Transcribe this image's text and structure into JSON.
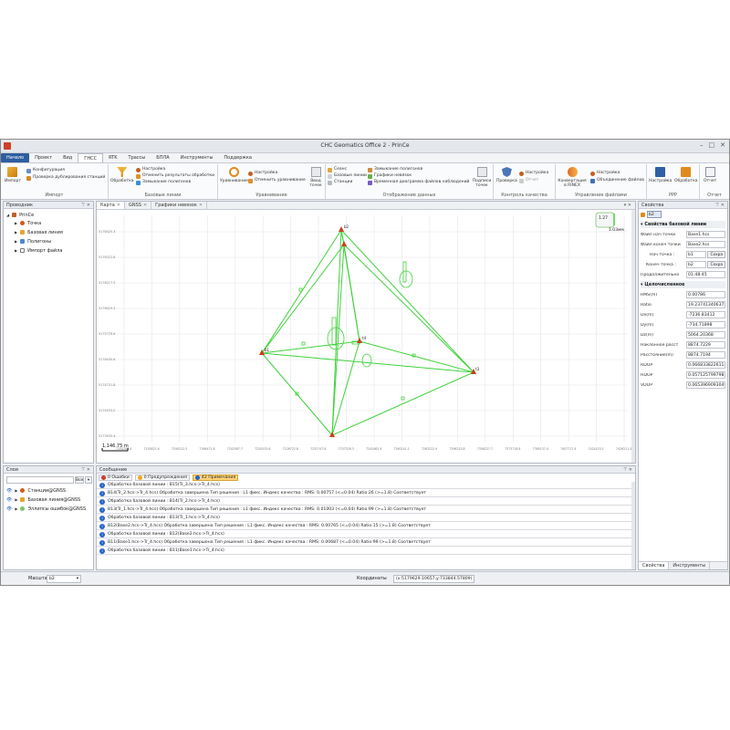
{
  "app": {
    "title": "CHC Geomatics Office 2 - PrinCe"
  },
  "menu": {
    "items": [
      "Начало",
      "Проект",
      "Вид",
      "ГНСС",
      "RTK",
      "Трассы",
      "БПЛА",
      "Инструменты",
      "Поддержка"
    ],
    "active": "ГНСС"
  },
  "ribbon": {
    "import": {
      "title": "Импорт",
      "big": "Импорт",
      "b1": "Конфигурация",
      "b2": "Проверка дублирования станций"
    },
    "baselines": {
      "title": "Базовые линии",
      "big": "Обработка",
      "b1": "Настройка",
      "b2": "Отменить результаты обработки",
      "b3": "Замыкание полигонов"
    },
    "adjust": {
      "title": "Уравнивание",
      "big": "Уравнивание",
      "b1": "Настройка",
      "b2": "Отменить уравнивание",
      "big2": "Ввод точек"
    },
    "display": {
      "title": "Отображение данных",
      "b1": "Сеанс",
      "b2": "Базовые линии",
      "b3": "Станции",
      "b4": "Замыкание полигонов",
      "b5": "Графики невязок",
      "b6": "Временная диаграмма файлов наблюдений",
      "big": "Подписи точек"
    },
    "quality": {
      "title": "Контроль качества",
      "big": "Проверка",
      "b1": "Настройка",
      "b2": "Отчет"
    },
    "files": {
      "title": "Управление файлами",
      "big": "Конвертация в RINEX",
      "b1": "Настройка",
      "b2": "Объединение файлов"
    },
    "ppp": {
      "title": "PPP",
      "big1": "Настройка",
      "big2": "Обработка"
    },
    "report": {
      "title": "Отчет",
      "big": "Отчет"
    }
  },
  "explorer": {
    "title": "Проводник",
    "root": "PrinCe",
    "items": [
      "Точка",
      "Базовая линия",
      "Полигоны",
      "Импорт файла"
    ]
  },
  "layers": {
    "title": "Слои",
    "placeholder": "",
    "all_label": "Все",
    "items": [
      "Станции@GNSS",
      "Базовая линия@GNSS",
      "Эллипсы ошибок@GNSS"
    ]
  },
  "map_tabs": [
    "Карта",
    "GNSS",
    "Графики невязок"
  ],
  "map": {
    "y_ticks": [
      "5176425.3",
      "5176322.8",
      "5176217.5",
      "5176029.3",
      "5175729.6",
      "5176430.6",
      "5174731.8",
      "5174033.0",
      "5173935.4"
    ],
    "x_ticks": [
      "7150203.4",
      "7155821.6",
      "7190212.5",
      "7198471.8",
      "7202587.7",
      "7220533.8",
      "7226722.8",
      "7232747.8",
      "7237328.3",
      "7242463.9",
      "7260241.1",
      "7263222.9",
      "7296215.8",
      "7356227.7",
      "7373718.8",
      "7385137.4",
      "7407717.4",
      "7424153.1",
      "7426211.4"
    ],
    "scale_label": "1,146.75 m",
    "compass_value": "1.27",
    "compass_unit": "1.03мм"
  },
  "messages": {
    "title": "Сообщение",
    "filters": {
      "errors": "0 Ошибки",
      "warnings": "0 Предупреждения",
      "info": "42 Примечания"
    },
    "rows": [
      "Обработка базовой линии :  B15(Tr_3.hcs->Tr_4.hcs)",
      "B14(Tr_2.hcs->Tr_4.hcs)  Обработка завершена   Тип решения :   L1 фикс.   Индекс качества : RMS: 0.00757  (<=0.04) Ratio:26  (>=1.8)  Соответствует",
      "Обработка базовой линии :  B14(Tr_2.hcs->Tr_4.hcs)",
      "B13(Tr_1.hcs->Tr_4.hcs)  Обработка завершена   Тип решения :   L1 фикс.   Индекс качества : RMS: 0.01003  (<=0.04) Ratio:99  (>=1.8)  Соответствует",
      "Обработка базовой линии :  B13(Tr_1.hcs->Tr_4.hcs)",
      "B12(Base2.hcs->Tr_4.hcs)  Обработка завершена   Тип решения :   L1 фикс.   Индекс качества : RMS: 0.00765  (<=0.04) Ratio:15  (>=1.8)  Соответствует",
      "Обработка базовой линии :  B12(Base2.hcs->Tr_4.hcs)",
      "B11(Base1.hcs->Tr_4.hcs)  Обработка завершена   Тип решения :   L1 фикс.   Индекс качества : RMS: 0.00687  (<=0.04) Ratio:99  (>=1.8)  Соответствует",
      "Обработка базовой линии :  B11(Base1.hcs->Tr_4.hcs)"
    ]
  },
  "properties": {
    "title": "Свойства",
    "selected": "b2",
    "section1": "Свойства базовой линии",
    "start_file_label": "Файл нач точки",
    "start_file": "Base1.hcs",
    "end_file_label": "Файл конеч точки",
    "end_file": "Base2.hcs",
    "start_point_label": "Нач точка :",
    "start_point": "b1",
    "end_point_label": "Конеч точка :",
    "end_point": "b2",
    "view_label": "Сохра",
    "duration_label": "Продолжительно",
    "duration": "01:48:45",
    "section2": "Целочисленное",
    "rms_label": "RMS(m)",
    "rms": "0.00786",
    "ratio_label": "Ratio",
    "ratio": "19.23741340637213",
    "dx_label": "Dx(m)",
    "dx": "-7236.83412",
    "dy_label": "Dy(m)",
    "dy": "-734.71898",
    "dz_label": "Dz(m)",
    "dz": "5064.20368",
    "slope_label": "Наклонное расст",
    "slope": "8874.7229",
    "dist_label": "Расстояние(m)",
    "dist": "8874.7194",
    "rdop_label": "RDOP",
    "rdop": "0.06683382261143",
    "hdop_label": "HDOP",
    "hdop": "0.05712579979812",
    "vdop_label": "VDOP",
    "vdop": "0.06539690930496",
    "tabs": [
      "Свойства",
      "Инструменты"
    ]
  },
  "status": {
    "scale_label": "Масштаб",
    "scale_value": "b2",
    "coords_label": "Координаты",
    "coords_value": "(x:5179629.10657,y:733844.57809)"
  },
  "colors": {
    "accent": "#2e5e9e",
    "baseline": "#3fd23a",
    "station": "#c8401a",
    "info": "#2563c9"
  }
}
